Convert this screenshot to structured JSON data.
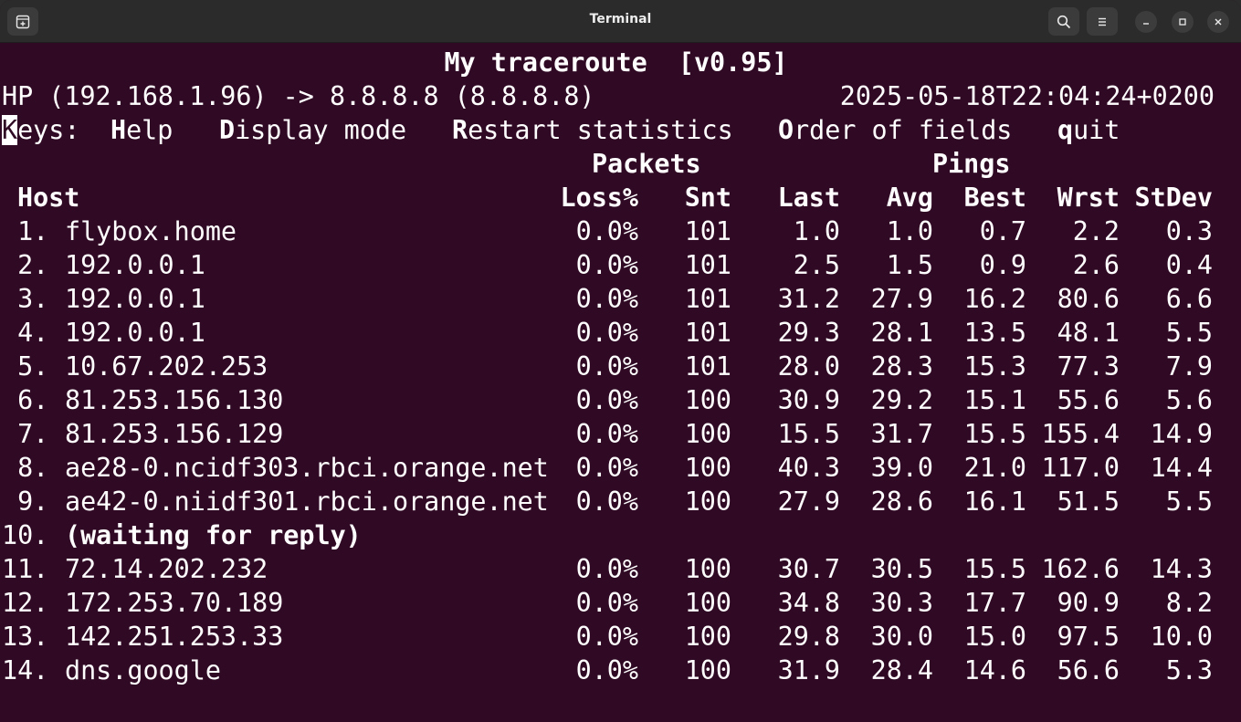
{
  "window": {
    "title": "Terminal"
  },
  "icons": {
    "new_tab": "new-tab-icon",
    "search": "search-icon",
    "menu": "hamburger-menu-icon",
    "minimize": "minimize-icon",
    "maximize": "maximize-icon",
    "close": "close-icon"
  },
  "colors": {
    "terminal_bg": "#300a24",
    "titlebar_bg": "#2b2b2b",
    "text": "#ffffff"
  },
  "mtr": {
    "title": "My traceroute  [v0.95]",
    "source": "HP (192.168.1.96) -> 8.8.8.8 (8.8.8.8)",
    "timestamp": "2025-05-18T22:04:24+0200",
    "keys": {
      "label_hot": "K",
      "label_rest": "eys:",
      "help_hot": "H",
      "help_rest": "elp",
      "display_hot": "D",
      "display_rest": "isplay mode",
      "restart_hot": "R",
      "restart_rest": "estart statistics",
      "order_hot": "O",
      "order_rest": "rder of fields",
      "quit_hot": "q",
      "quit_rest": "uit"
    },
    "group_headers": {
      "packets": "Packets",
      "pings": "Pings"
    },
    "columns": {
      "host": "Host",
      "loss": "Loss%",
      "snt": "Snt",
      "last": "Last",
      "avg": "Avg",
      "best": "Best",
      "wrst": "Wrst",
      "stdev": "StDev"
    },
    "rows": [
      {
        "num": " 1.",
        "host": "flybox.home",
        "loss": "0.0%",
        "snt": "101",
        "last": "1.0",
        "avg": "1.0",
        "best": "0.7",
        "wrst": "2.2",
        "stdev": "0.3"
      },
      {
        "num": " 2.",
        "host": "192.0.0.1",
        "loss": "0.0%",
        "snt": "101",
        "last": "2.5",
        "avg": "1.5",
        "best": "0.9",
        "wrst": "2.6",
        "stdev": "0.4"
      },
      {
        "num": " 3.",
        "host": "192.0.0.1",
        "loss": "0.0%",
        "snt": "101",
        "last": "31.2",
        "avg": "27.9",
        "best": "16.2",
        "wrst": "80.6",
        "stdev": "6.6"
      },
      {
        "num": " 4.",
        "host": "192.0.0.1",
        "loss": "0.0%",
        "snt": "101",
        "last": "29.3",
        "avg": "28.1",
        "best": "13.5",
        "wrst": "48.1",
        "stdev": "5.5"
      },
      {
        "num": " 5.",
        "host": "10.67.202.253",
        "loss": "0.0%",
        "snt": "101",
        "last": "28.0",
        "avg": "28.3",
        "best": "15.3",
        "wrst": "77.3",
        "stdev": "7.9"
      },
      {
        "num": " 6.",
        "host": "81.253.156.130",
        "loss": "0.0%",
        "snt": "100",
        "last": "30.9",
        "avg": "29.2",
        "best": "15.1",
        "wrst": "55.6",
        "stdev": "5.6"
      },
      {
        "num": " 7.",
        "host": "81.253.156.129",
        "loss": "0.0%",
        "snt": "100",
        "last": "15.5",
        "avg": "31.7",
        "best": "15.5",
        "wrst": "155.4",
        "stdev": "14.9"
      },
      {
        "num": " 8.",
        "host": "ae28-0.ncidf303.rbci.orange.net",
        "loss": "0.0%",
        "snt": "100",
        "last": "40.3",
        "avg": "39.0",
        "best": "21.0",
        "wrst": "117.0",
        "stdev": "14.4"
      },
      {
        "num": " 9.",
        "host": "ae42-0.niidf301.rbci.orange.net",
        "loss": "0.0%",
        "snt": "100",
        "last": "27.9",
        "avg": "28.6",
        "best": "16.1",
        "wrst": "51.5",
        "stdev": "5.5"
      },
      {
        "num": "10.",
        "host": "(waiting for reply)",
        "waiting": true
      },
      {
        "num": "11.",
        "host": "72.14.202.232",
        "loss": "0.0%",
        "snt": "100",
        "last": "30.7",
        "avg": "30.5",
        "best": "15.5",
        "wrst": "162.6",
        "stdev": "14.3"
      },
      {
        "num": "12.",
        "host": "172.253.70.189",
        "loss": "0.0%",
        "snt": "100",
        "last": "34.8",
        "avg": "30.3",
        "best": "17.7",
        "wrst": "90.9",
        "stdev": "8.2"
      },
      {
        "num": "13.",
        "host": "142.251.253.33",
        "loss": "0.0%",
        "snt": "100",
        "last": "29.8",
        "avg": "30.0",
        "best": "15.0",
        "wrst": "97.5",
        "stdev": "10.0"
      },
      {
        "num": "14.",
        "host": "dns.google",
        "loss": "0.0%",
        "snt": "100",
        "last": "31.9",
        "avg": "28.4",
        "best": "14.6",
        "wrst": "56.6",
        "stdev": "5.3"
      }
    ]
  }
}
